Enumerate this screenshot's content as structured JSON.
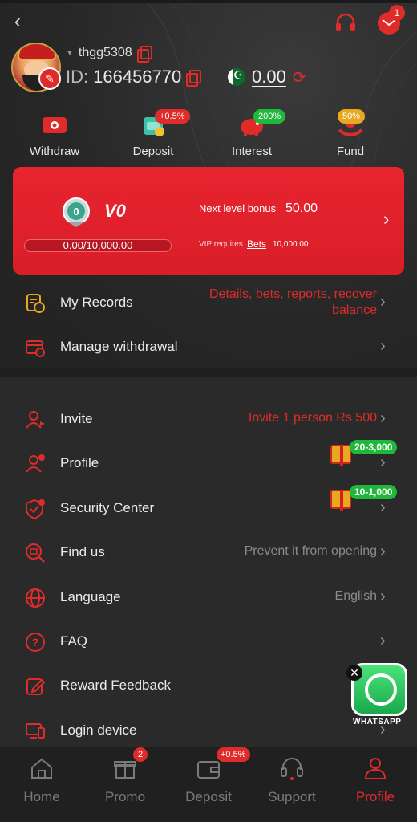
{
  "header": {
    "username": "thgg5308",
    "id_label": "ID:",
    "id_value": "166456770",
    "balance": "0.00",
    "mail_badge": "1"
  },
  "quick_actions": [
    {
      "label": "Withdraw",
      "badge": ""
    },
    {
      "label": "Deposit",
      "badge": "+0.5%"
    },
    {
      "label": "Interest",
      "badge": "200%"
    },
    {
      "label": "Fund",
      "badge": "50%"
    }
  ],
  "vip": {
    "medal_level": "0",
    "level": "V0",
    "progress_text": "0.00/10,000.00",
    "progress_fraction": 0,
    "next_bonus_label": "Next level bonus",
    "next_bonus_value": "50.00",
    "requires_label": "VIP requires",
    "bets_label": "Bets",
    "requires_value": "10,000.00"
  },
  "records": {
    "label": "My Records",
    "value_line1": "Details, bets, reports, recover",
    "value_line2": "balance"
  },
  "manage_withdrawal": {
    "label": "Manage withdrawal"
  },
  "menu": [
    {
      "label": "Invite",
      "value": "Invite 1 person Rs 500"
    },
    {
      "label": "Profile",
      "value": "",
      "gift": "20-3,000"
    },
    {
      "label": "Security Center",
      "value": "",
      "gift": "10-1,000"
    },
    {
      "label": "Find us",
      "value": "Prevent it from opening"
    },
    {
      "label": "Language",
      "value": "English"
    },
    {
      "label": "FAQ",
      "value": ""
    },
    {
      "label": "Reward Feedback",
      "value": ""
    },
    {
      "label": "Login device",
      "value": ""
    }
  ],
  "whatsapp": {
    "label": "WHATSAPP",
    "close": "✕"
  },
  "bottom_nav": [
    {
      "label": "Home",
      "badge": ""
    },
    {
      "label": "Promo",
      "badge": "2"
    },
    {
      "label": "Deposit",
      "badge": "+0.5%"
    },
    {
      "label": "Support",
      "badge": ""
    },
    {
      "label": "Profile",
      "badge": ""
    }
  ],
  "colors": {
    "accent": "#e02b2b",
    "background": "#2a2a2a",
    "value_red": "#e02b2b",
    "value_gray": "#8a8a8a",
    "green_badge": "#1fb83a"
  }
}
